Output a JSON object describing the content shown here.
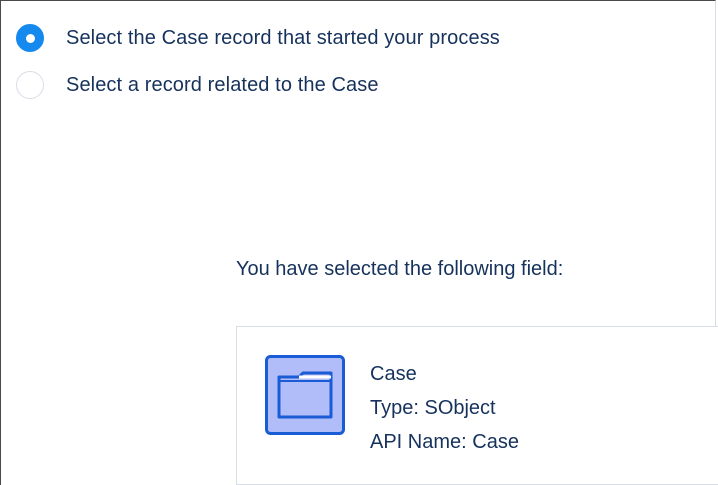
{
  "record_options": [
    {
      "label": "Select the Case record that started your process",
      "selected": true
    },
    {
      "label": "Select a record related to the Case",
      "selected": false
    }
  ],
  "selection": {
    "heading": "You have selected the following field:",
    "field": {
      "name": "Case",
      "type_line": "Type: SObject",
      "api_line": "API Name: Case",
      "icon": "folder-icon"
    }
  },
  "colors": {
    "accent": "#1589ee",
    "text": "#16325c",
    "border": "#d8dde6",
    "icon_fill": "#b1bdf8",
    "icon_border": "#1a5bd6"
  }
}
